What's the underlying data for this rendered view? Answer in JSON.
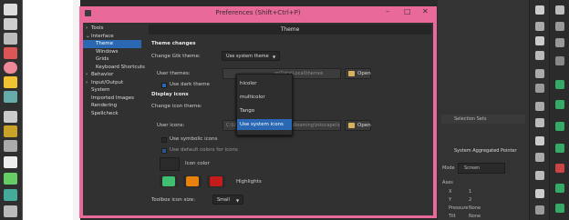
{
  "dialog": {
    "title": "Preferences (Shift+Ctrl+P)",
    "min": "–",
    "max": "□",
    "close": "✕"
  },
  "tree": [
    {
      "label": "Tools",
      "expander": "›",
      "indent": 0
    },
    {
      "label": "Interface",
      "expander": "⌄",
      "indent": 0
    },
    {
      "label": "Theme",
      "expander": "",
      "indent": 1,
      "selected": true
    },
    {
      "label": "Windows",
      "expander": "",
      "indent": 1
    },
    {
      "label": "Grids",
      "expander": "",
      "indent": 1
    },
    {
      "label": "Keyboard Shortcuts",
      "expander": "",
      "indent": 1
    },
    {
      "label": "Behavior",
      "expander": "›",
      "indent": 0
    },
    {
      "label": "Input/Output",
      "expander": "›",
      "indent": 0
    },
    {
      "label": "System",
      "expander": "",
      "indent": 0
    },
    {
      "label": "Imported Images",
      "expander": "",
      "indent": 0
    },
    {
      "label": "Rendering",
      "expander": "",
      "indent": 0
    },
    {
      "label": "Spellcheck",
      "expander": "",
      "indent": 0
    }
  ],
  "theme": {
    "header": "Theme",
    "theme_changes": "Theme changes",
    "change_gtk_label": "Change Gtk theme:",
    "gtk_theme_value": "Use system theme",
    "user_themes_label": "User themes:",
    "user_themes_path": "ppData\\Local\\themes",
    "open_label": "Open",
    "dark_theme_label": "Use dark theme",
    "display_icons": "Display icons",
    "change_icon_label": "Change icon theme:",
    "user_icons_label": "User icons:",
    "user_icons_path": "C:\\Users\\jhon.smith\\AppData\\Roaming\\inkscape\\ic",
    "symbolic_icons_label": "Use symbolic icons",
    "default_colors_label": "Use default colors for icons",
    "icon_color_label": "Icon color",
    "highlights_label": "Highlights",
    "toolbox_size_label": "Toolbox icon size:",
    "toolbox_size_value": "Small",
    "dropdown_arrow": "▼"
  },
  "icon_theme_options": [
    {
      "label": "hicolor",
      "selected": false
    },
    {
      "label": "multicolor",
      "selected": false
    },
    {
      "label": "Tango",
      "selected": false
    },
    {
      "label": "Use system icons",
      "selected": true
    }
  ],
  "colors": {
    "highlight_green": "#3fbf6f",
    "highlight_orange": "#e8820c",
    "highlight_red": "#c41b1b",
    "selection": "#2a68b4",
    "dialog_border": "#e96a9a"
  },
  "right_panel": {
    "selection_sets": "Selection Sets",
    "pointer_title": "System Aggregated Pointer",
    "mode_label": "Mode",
    "mode_value": "Screen",
    "axes_label": "Axes",
    "x_label": "X",
    "x_value": "1",
    "y_label": "Y",
    "y_value": "2",
    "pressure_label": "Pressure",
    "pressure_value": "None",
    "tilt_label": "Tilt",
    "tilt_value": "None"
  }
}
